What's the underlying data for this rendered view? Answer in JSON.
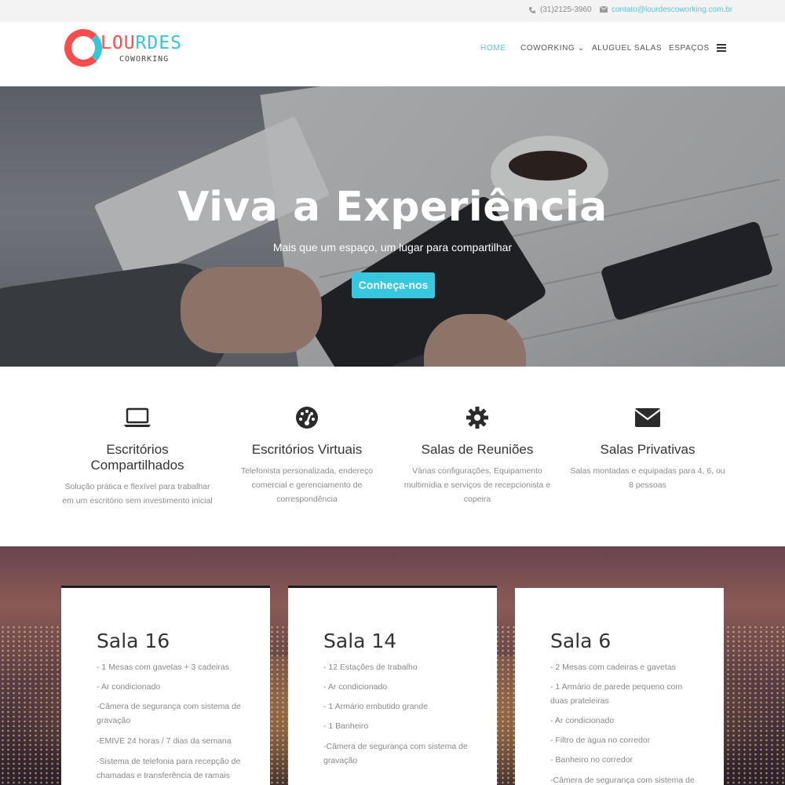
{
  "topbar": {
    "phone": "(31)2125-3960",
    "email": "contato@lourdescoworking.com.br",
    "phone_icon": "phone-icon",
    "email_icon": "envelope-icon"
  },
  "brand": {
    "name_red": "LOU",
    "name_blue": "RDES",
    "sub": "COWORKING",
    "colors": {
      "red": "#ff4b4b",
      "blue": "#37c5d9"
    }
  },
  "nav": {
    "items": [
      {
        "label": "HOME",
        "active": true
      },
      {
        "label": "COWORKING ⌄",
        "active": false
      },
      {
        "label": "ALUGUEL SALAS",
        "active": false
      },
      {
        "label": "ESPAÇOS",
        "active": false
      }
    ],
    "menu_icon": "hamburger-menu-icon"
  },
  "hero": {
    "title": "Viva a Experiência",
    "tagline": "Mais que um espaço, um lugar para compartilhar",
    "cta": "Conheça-nos",
    "accent": "#37c8e0"
  },
  "features": [
    {
      "icon": "laptop-icon",
      "title": "Escritórios Compartilhados",
      "desc": "Solução prática e flexível para trabalhar em um escritório sem investimento inicial"
    },
    {
      "icon": "dashboard-icon",
      "title": "Escritórios Virtuais",
      "desc": "Telefonista personalizada, endereço comercial e gerenciamento de correspondência"
    },
    {
      "icon": "gear-icon",
      "title": "Salas de Reuniões",
      "desc": "Várias configurações, Equipamento multimídia e serviços de recepcionista e copeira"
    },
    {
      "icon": "envelope-icon",
      "title": "Salas Privativas",
      "desc": "Salas montadas e equipadas para 4, 6, ou 8 pessoas"
    }
  ],
  "rooms": [
    {
      "title": "Sala 16",
      "items": [
        "- 1 Mesas com gavetas + 3 cadeiras",
        "- Ar condicionado",
        "-Câmera de segurança com sistema de gravação",
        "-EMIVE 24 horas / 7 dias da semana",
        "-Sistema de telefonia para recepção de chamadas e transferência de ramais"
      ]
    },
    {
      "title": "Sala 14",
      "items": [
        "- 12 Estações de trabalho",
        "- Ar condicionado",
        "- 1 Armário embutido grande",
        "- 1 Banheiro",
        "-Câmera de segurança com sistema de gravação"
      ]
    },
    {
      "title": "Sala 6",
      "items": [
        " - 2 Mesas com cadeiras e gavetas",
        "- 1 Armário de parede pequeno com duas prateleiras",
        "- Ar condicionado",
        "- Filtro de água no corredor",
        "- Banheiro no corredor",
        "-Câmera de segurança com sistema de gravação"
      ]
    }
  ]
}
